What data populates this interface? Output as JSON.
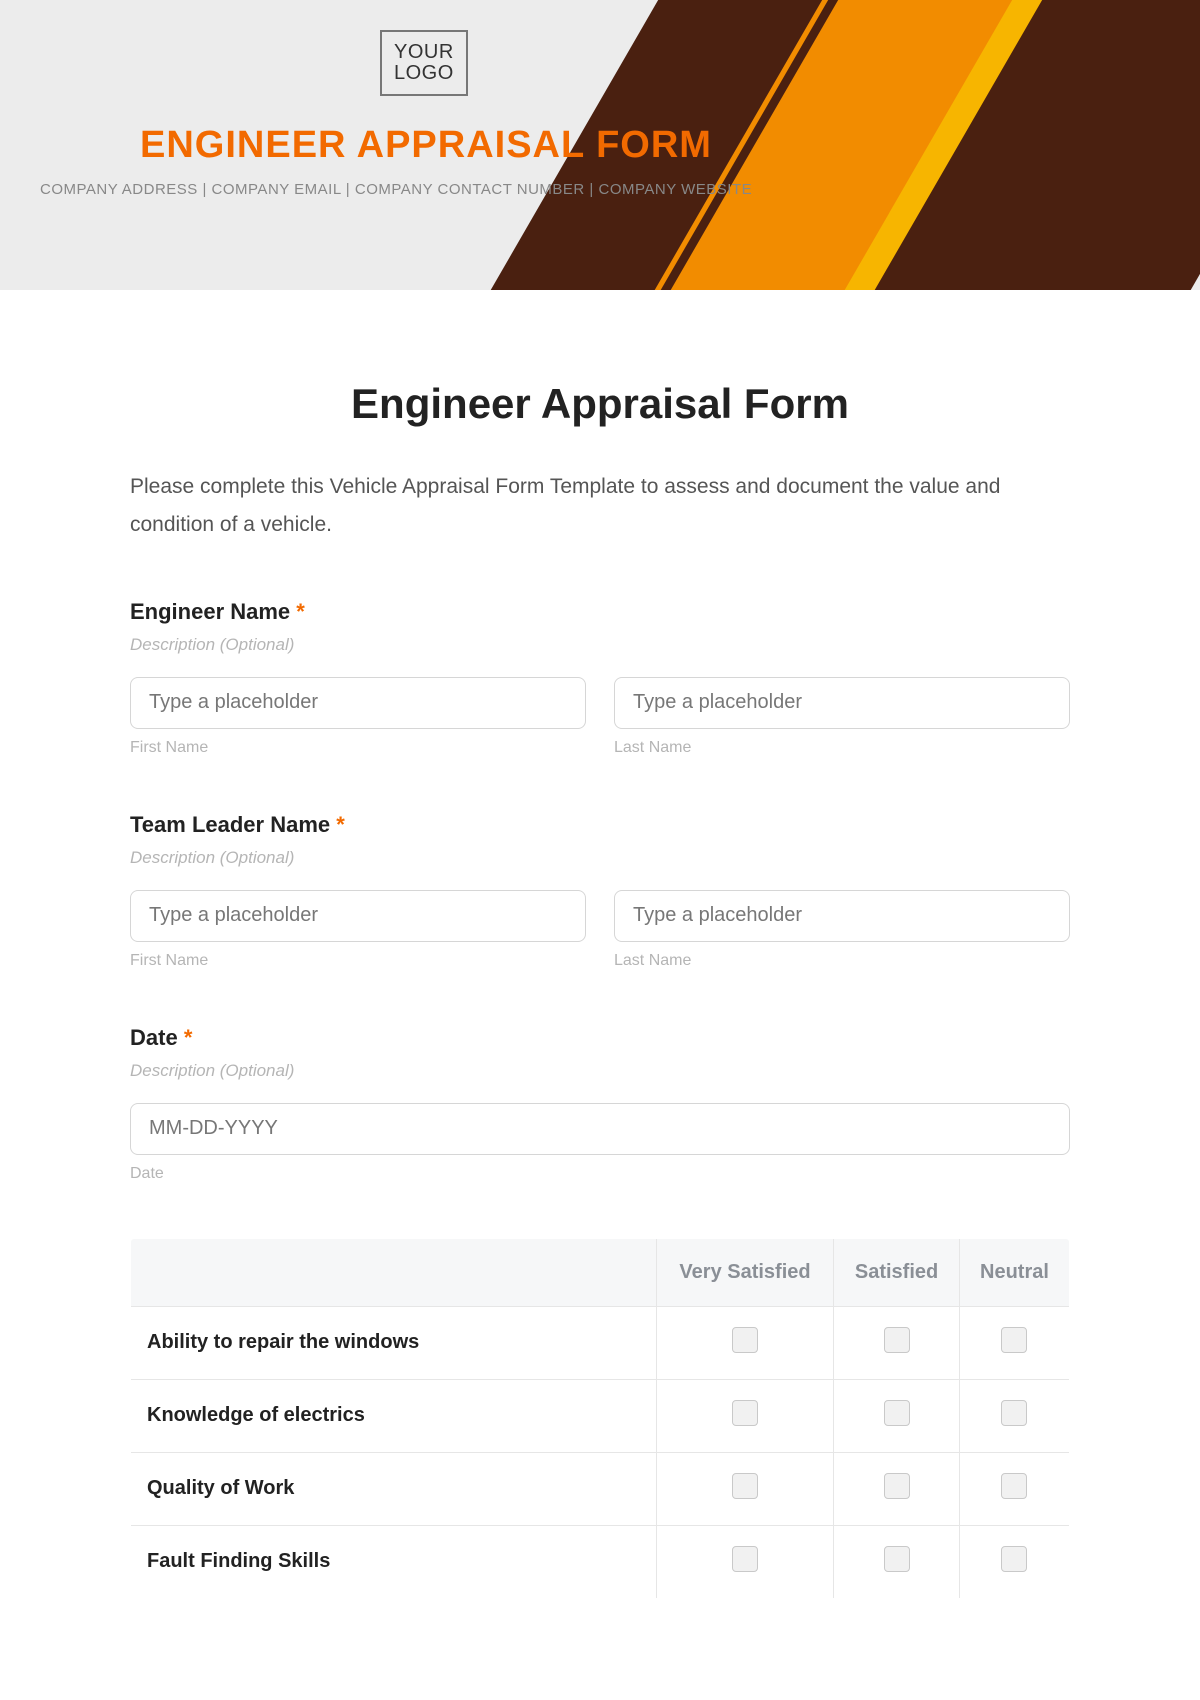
{
  "banner": {
    "logo_text": "YOUR\nLOGO",
    "title": "ENGINEER APPRAISAL FORM",
    "subline": "COMPANY ADDRESS | COMPANY EMAIL | COMPANY CONTACT NUMBER | COMPANY WEBSITE"
  },
  "form": {
    "title": "Engineer Appraisal Form",
    "intro": "Please complete this Vehicle Appraisal Form Template to assess and document the value and condition of a vehicle.",
    "required_mark": "*",
    "description_placeholder": "Description (Optional)",
    "input_placeholder": "Type a placeholder",
    "sublabels": {
      "first_name": "First Name",
      "last_name": "Last Name",
      "date": "Date"
    },
    "fields": {
      "engineer_name": {
        "label": "Engineer Name"
      },
      "team_leader_name": {
        "label": "Team Leader Name"
      },
      "date": {
        "label": "Date",
        "placeholder": "MM-DD-YYYY"
      }
    },
    "rating": {
      "columns": [
        "Very Satisfied",
        "Satisfied",
        "Neutral"
      ],
      "rows": [
        "Ability to repair the windows",
        "Knowledge of electrics",
        "Quality of Work",
        "Fault Finding Skills"
      ]
    }
  }
}
